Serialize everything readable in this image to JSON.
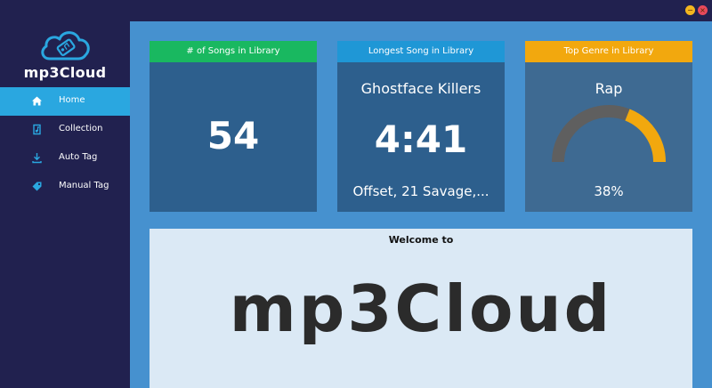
{
  "app": {
    "name": "mp3Cloud",
    "window_controls": {
      "minimize": "−",
      "close": "×"
    }
  },
  "sidebar": {
    "items": [
      {
        "label": "Home",
        "icon": "home-icon",
        "active": true
      },
      {
        "label": "Collection",
        "icon": "collection-icon",
        "active": false
      },
      {
        "label": "Auto Tag",
        "icon": "download-icon",
        "active": false
      },
      {
        "label": "Manual Tag",
        "icon": "tag-icon",
        "active": false
      }
    ]
  },
  "cards": {
    "songs_count": {
      "title": "# of Songs in Library",
      "value": "54"
    },
    "longest_song": {
      "title": "Longest Song in Library",
      "song": "Ghostface Killers",
      "length": "4:41",
      "artist": "Offset, 21 Savage,..."
    },
    "top_genre": {
      "title": "Top Genre in Library",
      "genre": "Rap",
      "percent_label": "38%",
      "percent": 0.38
    }
  },
  "welcome": {
    "heading": "Welcome to",
    "logo_text": "mp3Cloud"
  },
  "colors": {
    "sidebar_bg": "#21214f",
    "active_nav": "#2aa7e0",
    "main_bg": "#4691cf",
    "card_bg": "#2d5f8d",
    "songs_header": "#19b860",
    "longest_header": "#1f97d6",
    "genre_header": "#f2a80e",
    "gauge_track": "#5f5f5f",
    "gauge_fill": "#f2a80e"
  }
}
